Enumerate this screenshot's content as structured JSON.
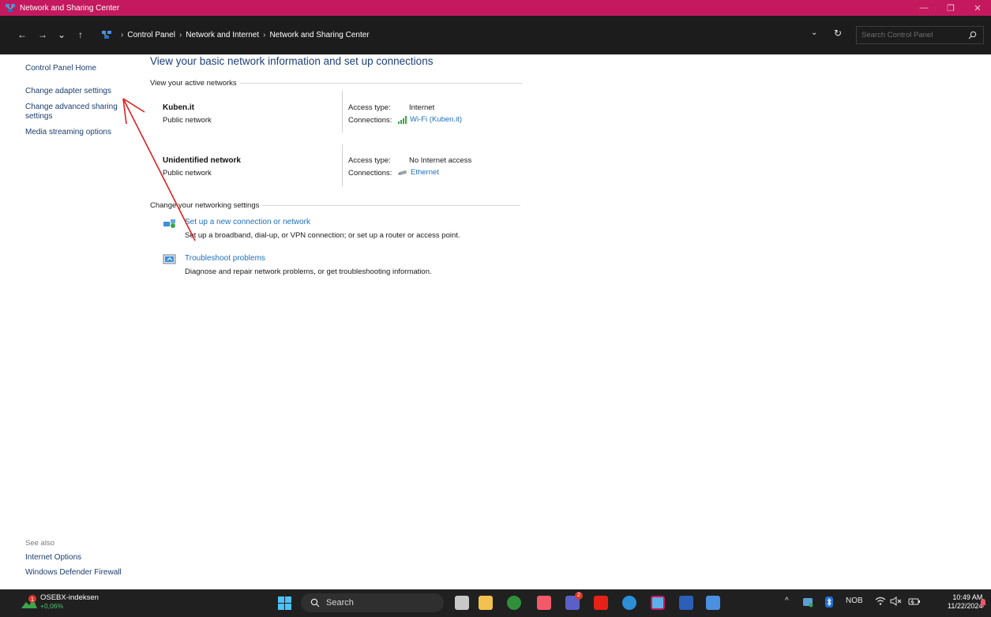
{
  "window": {
    "title": "Network and Sharing Center",
    "minimize_glyph": "—",
    "restore_glyph": "❐",
    "close_glyph": "✕"
  },
  "addressbar": {
    "back_glyph": "←",
    "forward_glyph": "→",
    "recent_glyph": "⌄",
    "up_glyph": "↑",
    "breadcrumbs": [
      "Control Panel",
      "Network and Internet",
      "Network and Sharing Center"
    ],
    "separator": "›",
    "dropdown_glyph": "⌄",
    "refresh_glyph": "↻",
    "search_placeholder": "Search Control Panel"
  },
  "sidebar": {
    "home": "Control Panel Home",
    "links": [
      "Change adapter settings",
      "Change advanced sharing",
      "settings",
      "Media streaming options"
    ],
    "see_also_label": "See also",
    "see_also": [
      "Internet Options",
      "Windows Defender Firewall"
    ]
  },
  "main": {
    "title": "View your basic network information and set up connections",
    "active_networks_label": "View your active networks",
    "networks": [
      {
        "name": "Kuben.it",
        "type": "Public network",
        "access_label": "Access type:",
        "access_value": "Internet",
        "connections_label": "Connections:",
        "connection": "Wi-Fi (Kuben.it)",
        "connection_icon": "wifi-signal-icon"
      },
      {
        "name": "Unidentified network",
        "type": "Public network",
        "access_label": "Access type:",
        "access_value": "No Internet access",
        "connections_label": "Connections:",
        "connection": "Ethernet",
        "connection_icon": "ethernet-icon"
      }
    ],
    "change_settings_label": "Change your networking settings",
    "tasks": [
      {
        "link": "Set up a new connection or network",
        "desc": "Set up a broadband, dial-up, or VPN connection; or set up a router or access point.",
        "icon": "new-connection-icon"
      },
      {
        "link": "Troubleshoot problems",
        "desc": "Diagnose and repair network problems, or get troubleshooting information.",
        "icon": "troubleshoot-icon"
      }
    ]
  },
  "taskbar": {
    "widget_title": "OSEBX-indeksen",
    "widget_sub": "+0,06%",
    "widget_badge": "1",
    "search_label": "Search",
    "teams_badge": "2",
    "tray_chevron": "^",
    "language": "NOB",
    "time": "10:49 AM",
    "date": "11/22/2024"
  },
  "colors": {
    "titlebar": "#c4195e",
    "link": "#1f6fbf",
    "title": "#1e3f7a",
    "annotation_arrow": "#e02020"
  }
}
